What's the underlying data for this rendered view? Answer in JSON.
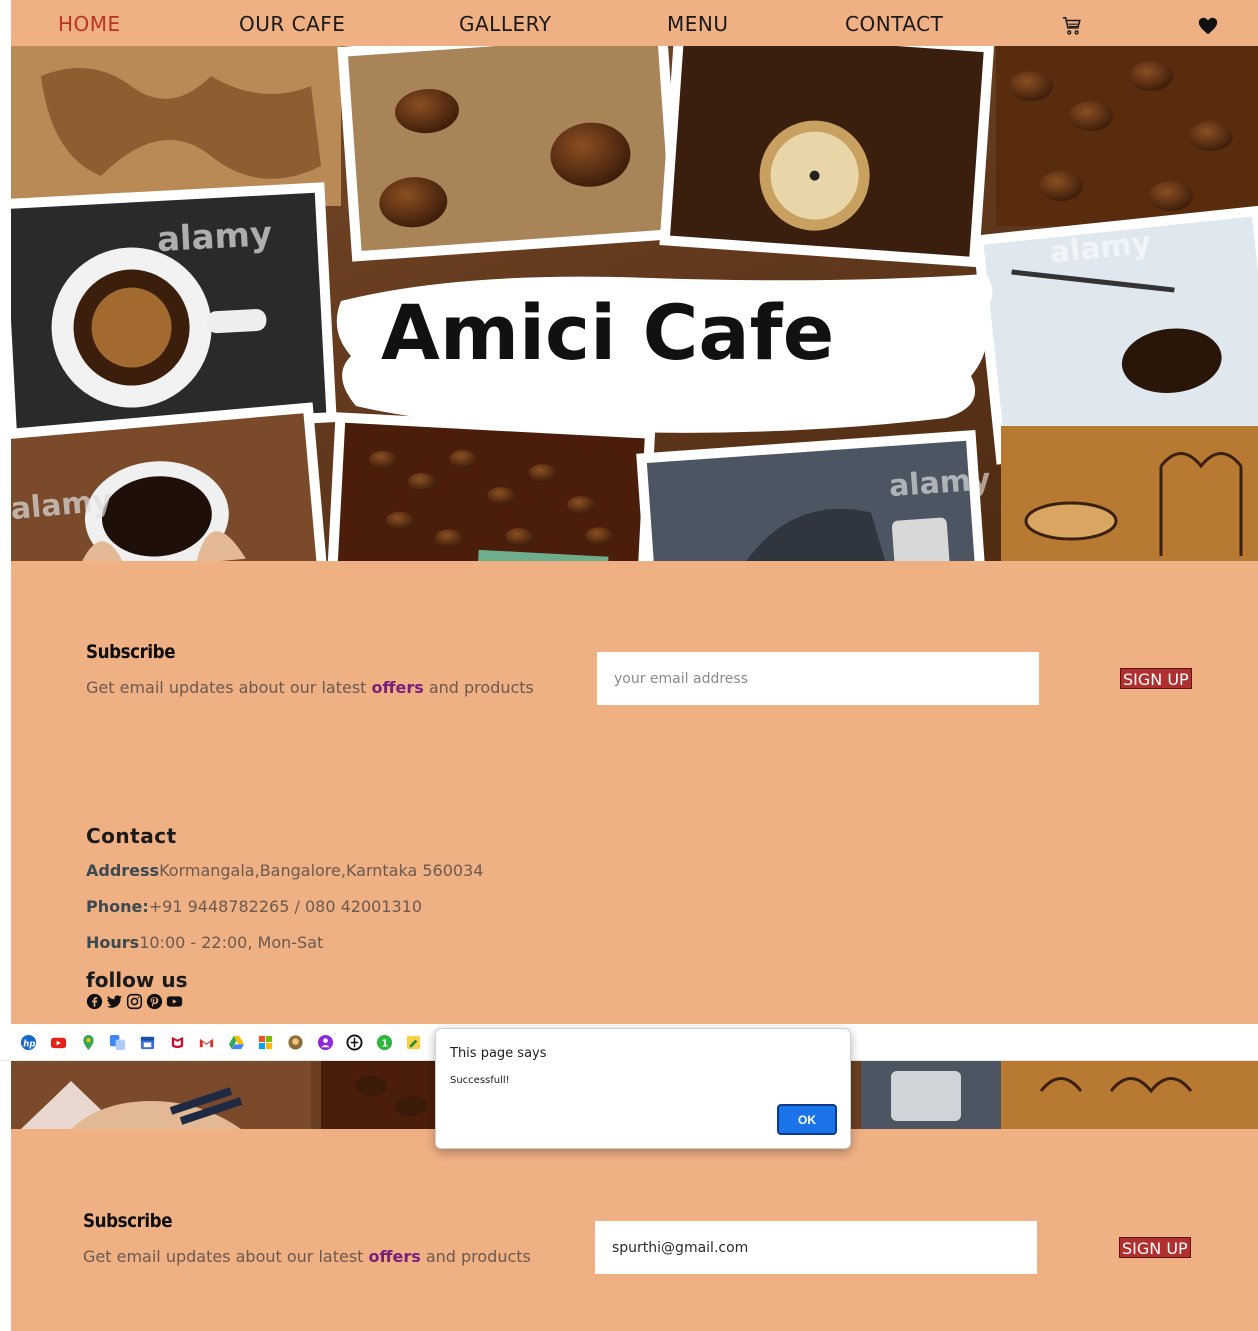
{
  "nav": {
    "items": [
      {
        "label": "HOME"
      },
      {
        "label": "OUR CAFE"
      },
      {
        "label": "GALLERY"
      },
      {
        "label": "MENU"
      },
      {
        "label": "CONTACT"
      }
    ],
    "active": "HOME",
    "icons": [
      "cart-icon",
      "heart-icon"
    ]
  },
  "hero": {
    "title": "Amici Cafe",
    "watermarks": [
      "alamy",
      "alamy",
      "alamy",
      "alamy"
    ]
  },
  "subscribe_top": {
    "title": "Subscribe",
    "desc_before": "Get email updates about our latest ",
    "desc_bold": "offers",
    "desc_after": " and products",
    "email_placeholder": "your email address",
    "email_value": "",
    "button_label": "SIGN UP"
  },
  "contact": {
    "title": "Contact",
    "address_label": "Address",
    "address_value": "Kormangala,Bangalore,Karntaka 560034",
    "phone_label": "Phone:",
    "phone_value": "+91 9448782265 / 080 42001310",
    "hours_label": "Hours",
    "hours_value": "10:00 - 22:00, Mon-Sat",
    "follow_title": "follow us",
    "social_icons": [
      "facebook-icon",
      "twitter-icon",
      "instagram-icon",
      "pinterest-icon",
      "youtube-icon"
    ]
  },
  "bookmarks": {
    "icons": [
      "hp-icon",
      "youtube-icon",
      "maps-icon",
      "translate-icon",
      "calendar-icon",
      "mcafee-icon",
      "gmail-icon",
      "drive-icon",
      "microsoft-icon",
      "ai-icon",
      "contacts-icon",
      "globe-icon",
      "one-icon",
      "notes-icon"
    ]
  },
  "dialog": {
    "title": "This page says",
    "message": "Successfull!",
    "ok_label": "OK"
  },
  "subscribe_bottom": {
    "title": "Subscribe",
    "desc_before": "Get email updates about our latest ",
    "desc_bold": "offers",
    "desc_after": " and products",
    "email_value": "spurthi@gmail.com",
    "button_label": "SIGN UP"
  },
  "colors": {
    "page_bg": "#efb084",
    "nav_active": "#b83526",
    "button_bg": "#b0302f",
    "offers_color": "#7a1f7a",
    "dialog_ok": "#1a73e8"
  }
}
